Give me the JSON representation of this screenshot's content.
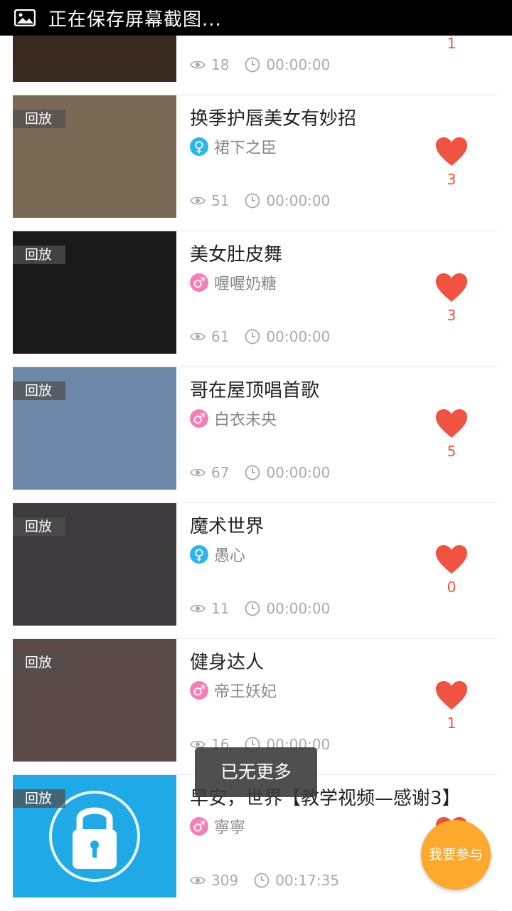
{
  "status_bar": {
    "text": "正在保存屏幕截图..."
  },
  "toast": "已无更多",
  "fab_label": "我要参与",
  "replay_label": "回放",
  "items": [
    {
      "title": "",
      "author": "",
      "gender": "",
      "views": "18",
      "duration": "00:00:00",
      "likes": "1",
      "thumb_color": "#3b2a20"
    },
    {
      "title": "换季护唇美女有妙招",
      "author": "裙下之臣",
      "gender": "female",
      "views": "51",
      "duration": "00:00:00",
      "likes": "3",
      "thumb_color": "#7a6a55"
    },
    {
      "title": "美女肚皮舞",
      "author": "喔喔奶糖",
      "gender": "male",
      "views": "61",
      "duration": "00:00:00",
      "likes": "3",
      "thumb_color": "#1a1a1a"
    },
    {
      "title": "哥在屋顶唱首歌",
      "author": "白衣未央",
      "gender": "male",
      "views": "67",
      "duration": "00:00:00",
      "likes": "5",
      "thumb_color": "#6d87a8"
    },
    {
      "title": "魔术世界",
      "author": "愚心",
      "gender": "female",
      "views": "11",
      "duration": "00:00:00",
      "likes": "0",
      "thumb_color": "#3d3b3d"
    },
    {
      "title": "健身达人",
      "author": "帝王妖妃",
      "gender": "male",
      "views": "16",
      "duration": "00:00:00",
      "likes": "1",
      "thumb_color": "#5b4a48"
    },
    {
      "title": "早安，世界【教学视频—感谢3】",
      "author": "寧寧",
      "gender": "male",
      "views": "309",
      "duration": "00:17:35",
      "likes": "",
      "thumb_color": "#1fa9e6"
    }
  ]
}
